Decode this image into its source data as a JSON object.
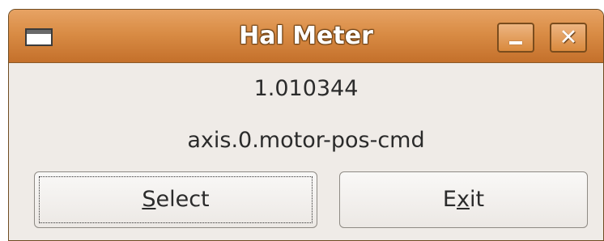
{
  "window": {
    "title": "Hal Meter",
    "icon": "window-icon"
  },
  "titlebar_buttons": {
    "minimize": "minimize-icon",
    "close": "close-icon",
    "close_glyph": "✕"
  },
  "meter": {
    "value": "1.010344",
    "pin_name": "axis.0.motor-pos-cmd"
  },
  "buttons": {
    "select": {
      "mnemonic": "S",
      "rest": "elect"
    },
    "exit": {
      "before": "E",
      "mnemonic": "x",
      "after": "it"
    }
  },
  "colors": {
    "titlebar": "#d98c45",
    "window_bg": "#efebe7"
  }
}
